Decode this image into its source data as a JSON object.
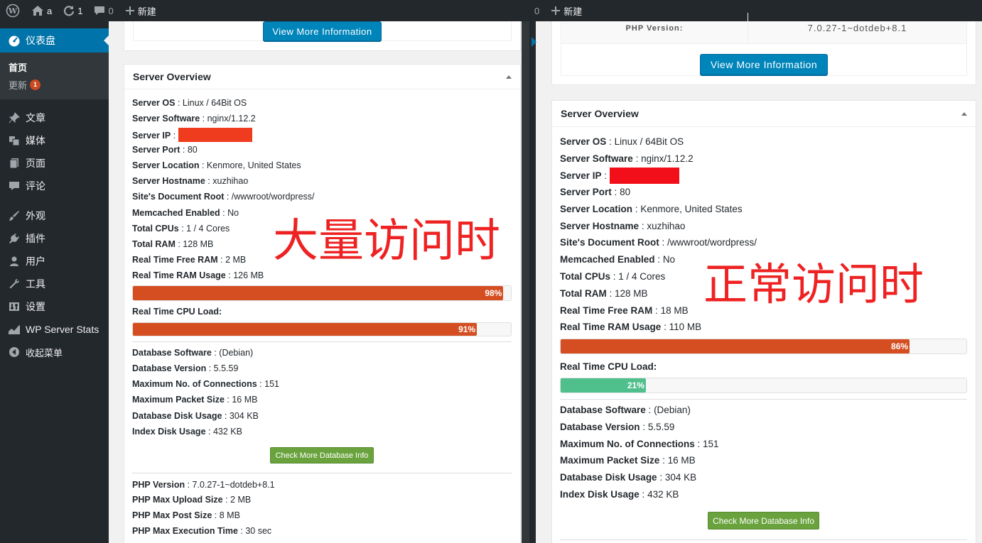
{
  "adminbar": {
    "site": "a",
    "updates_count": "1",
    "comments_count": "0",
    "new_label": "新建"
  },
  "sidebar": {
    "dashboard": "仪表盘",
    "home": "首页",
    "updates": "更新",
    "updates_badge": "1",
    "items": [
      {
        "label": "文章",
        "icon": "pin-icon"
      },
      {
        "label": "媒体",
        "icon": "media-icon"
      },
      {
        "label": "页面",
        "icon": "page-icon"
      },
      {
        "label": "评论",
        "icon": "comment-icon"
      },
      {
        "label": "外观",
        "icon": "brush-icon"
      },
      {
        "label": "插件",
        "icon": "plugin-icon"
      },
      {
        "label": "用户",
        "icon": "user-icon"
      },
      {
        "label": "工具",
        "icon": "wrench-icon"
      },
      {
        "label": "设置",
        "icon": "settings-icon"
      },
      {
        "label": "WP Server Stats",
        "icon": "chart-icon"
      },
      {
        "label": "收起菜单",
        "icon": "collapse-icon"
      }
    ]
  },
  "left": {
    "view_more_label": "View More Information",
    "title": "Server Overview",
    "server_os_label": "Server OS",
    "server_os": "Linux / 64Bit OS",
    "server_software_label": "Server Software",
    "server_software": "nginx/1.12.2",
    "server_ip_label": "Server IP",
    "server_port_label": "Server Port",
    "server_port": "80",
    "server_location_label": "Server Location",
    "server_location": "Kenmore, United States",
    "server_hostname_label": "Server Hostname",
    "server_hostname": "xuzhihao",
    "doc_root_label": "Site's Document Root",
    "doc_root": "/wwwroot/wordpress/",
    "memcached_label": "Memcached Enabled",
    "memcached": "No",
    "total_cpus_label": "Total CPUs",
    "total_cpus": "1 / 4 Cores",
    "total_ram_label": "Total RAM",
    "total_ram": "128 MB",
    "free_ram_label": "Real Time Free RAM",
    "free_ram": "2 MB",
    "ram_usage_label": "Real Time RAM Usage",
    "ram_usage": "126 MB",
    "ram_pct": 98,
    "ram_pct_label": "98%",
    "cpu_load_label": "Real Time CPU Load:",
    "cpu_pct": 91,
    "cpu_pct_label": "91%",
    "db_software_label": "Database Software",
    "db_software": "(Debian)",
    "db_version_label": "Database Version",
    "db_version": "5.5.59",
    "max_conn_label": "Maximum No. of Connections",
    "max_conn": "151",
    "max_packet_label": "Maximum Packet Size",
    "max_packet": "16 MB",
    "db_disk_label": "Database Disk Usage",
    "db_disk": "304 KB",
    "index_disk_label": "Index Disk Usage",
    "index_disk": "432 KB",
    "check_db_label": "Check More Database Info",
    "php_version_label": "PHP Version",
    "php_version": "7.0.27-1~dotdeb+8.1",
    "php_upload_label": "PHP Max Upload Size",
    "php_upload": "2 MB",
    "php_post_label": "PHP Max Post Size",
    "php_post": "8 MB",
    "php_exec_label": "PHP Max Execution Time",
    "php_exec": "30 sec",
    "annotation": "大量访问时"
  },
  "right": {
    "php_version_label": "PHP Version:",
    "php_version": "7.0.27-1~dotdeb+8.1",
    "view_more_label": "View More Information",
    "title": "Server Overview",
    "server_os_label": "Server OS",
    "server_os": "Linux / 64Bit OS",
    "server_software_label": "Server Software",
    "server_software": "nginx/1.12.2",
    "server_ip_label": "Server IP",
    "server_port_label": "Server Port",
    "server_port": "80",
    "server_location_label": "Server Location",
    "server_location": "Kenmore, United States",
    "server_hostname_label": "Server Hostname",
    "server_hostname": "xuzhihao",
    "doc_root_label": "Site's Document Root",
    "doc_root": "/wwwroot/wordpress/",
    "memcached_label": "Memcached Enabled",
    "memcached": "No",
    "total_cpus_label": "Total CPUs",
    "total_cpus": "1 / 4 Cores",
    "total_ram_label": "Total RAM",
    "total_ram": "128 MB",
    "free_ram_label": "Real Time Free RAM",
    "free_ram": "18 MB",
    "ram_usage_label": "Real Time RAM Usage",
    "ram_usage": "110 MB",
    "ram_pct": 86,
    "ram_pct_label": "86%",
    "cpu_load_label": "Real Time CPU Load:",
    "cpu_pct": 21,
    "cpu_pct_label": "21%",
    "db_software_label": "Database Software",
    "db_software": "(Debian)",
    "db_version_label": "Database Version",
    "db_version": "5.5.59",
    "max_conn_label": "Maximum No. of Connections",
    "max_conn": "151",
    "max_packet_label": "Maximum Packet Size",
    "max_packet": "16 MB",
    "db_disk_label": "Database Disk Usage",
    "db_disk": "304 KB",
    "index_disk_label": "Index Disk Usage",
    "index_disk": "432 KB",
    "check_db_label": "Check More Database Info",
    "annotation": "正常访问时"
  },
  "colors": {
    "bar_high": "#d54e21",
    "bar_low": "#4fbf8c",
    "redaction": "#f03c1e",
    "annotation": "#ee2222",
    "admin_bg": "#23282d",
    "accent": "#0073aa"
  }
}
